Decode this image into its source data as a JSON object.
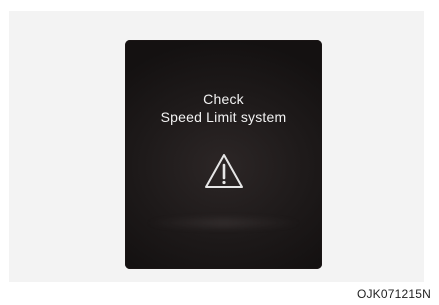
{
  "screen": {
    "title": "Check",
    "subtitle": "Speed Limit system",
    "icon": "warning-triangle-icon"
  },
  "figure_code": "OJK071215N",
  "colors": {
    "screen_bg": "#1e1a1a",
    "text": "#f2f2f2",
    "panel_bg": "#f3f3f3"
  }
}
